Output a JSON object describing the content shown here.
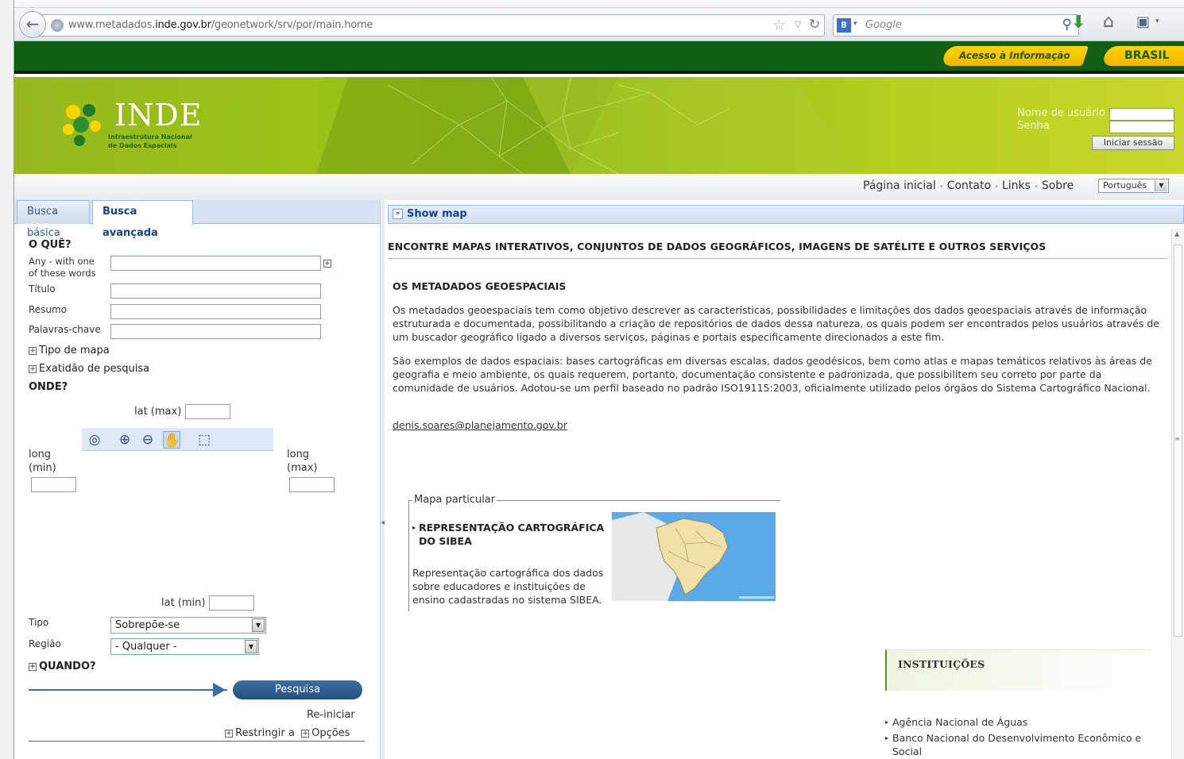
{
  "browser": {
    "url_prefix": "www.metadados.",
    "url_domain": "inde.gov.br",
    "url_path": "/geonetwork/srv/por/main.home",
    "search_engine": "Google",
    "icons": [
      "back-icon",
      "globe-icon",
      "star-icon",
      "reload-icon",
      "google-icon",
      "search-icon",
      "download-icon",
      "home-icon",
      "bookmark-icon"
    ]
  },
  "govbar": {
    "acesso": "Acesso à Informação",
    "brasil": "BRASIL",
    "colors": {
      "bar": "#0f5f14",
      "badge": "#ffd400"
    }
  },
  "banner": {
    "logo_name": "INDE",
    "logo_sub_1": "Infraestrutura Nacional",
    "logo_sub_2": "de Dados Espaciais",
    "username_label": "Nome de usuário",
    "password_label": "Senha",
    "login_button": "Iniciar sessão"
  },
  "nav": {
    "links": [
      "Página inicial",
      "Contato",
      "Links",
      "Sobre"
    ],
    "language": "Português"
  },
  "tabs": {
    "basic": "Busca básica",
    "advanced": "Busca avançada"
  },
  "search": {
    "what_heading": "O QUÊ?",
    "any_label_1": "Any - with one",
    "any_label_2": "of these words",
    "titulo_label": "Título",
    "resumo_label": "Resumo",
    "palavras_label": "Palavras-chave",
    "tipo_mapa": "Tipo de mapa",
    "exatidao": "Exatidão de pesquisa",
    "where_heading": "ONDE?",
    "lat_max": "lat (max)",
    "lat_min": "lat (min)",
    "long_min_1": "long",
    "long_min_2": "(min)",
    "long_max_1": "long",
    "long_max_2": "(max)",
    "tipo_label": "Tipo",
    "tipo_value": "Sobrepõe-se",
    "regiao_label": "Região",
    "regiao_value": "- Qualquer -",
    "when_heading": "QUANDO?",
    "search_button": "Pesquisa",
    "reset": "Re-iniciar",
    "restringir": "Restringir a",
    "opcoes": "Opções"
  },
  "main": {
    "show_map": "Show map",
    "title": "ENCONTRE MAPAS INTERATIVOS, CONJUNTOS DE DADOS GEOGRÁFICOS, IMAGENS DE SATÉLITE E OUTROS SERVIÇOS",
    "section_title": "OS METADADOS GEOESPACIAIS",
    "para1": "Os metadados geoespaciais tem como objetivo descrever as características, possibilidades e limitações dos dados geoespaciais através de informação estruturada e documentada, possibilitando a criação de repositórios de dados dessa natureza, os quais podem ser encontrados pelos usuários através de um buscador geográfico ligado a diversos serviços, páginas e portais especificamente direcionados a este fim.",
    "para2": "São exemplos de dados espaciais: bases cartográficas em diversas escalas, dados geodésicos, bem como atlas e mapas temáticos relativos às áreas de geografia e meio ambiente, os quais requerem, portanto, documentação consistente e padronizada, que possibilitem seu correto por parte da comunidade de usuários. Adotou-se um perfil baseado no padrão ISO19115:2003, oficialmente utilizado pelos órgãos do Sistema Cartográfico Nacional.",
    "email": "denis.soares@planejamento.gov.br",
    "featured_legend": "Mapa particular",
    "featured_title": "REPRESENTAÇÃO CARTOGRÁFICA DO SIBEA",
    "featured_desc": "Representação cartográfica dos dados sobre educadores e instituições de ensino cadastradas no sistema SIBEA.",
    "institutions_title": "INSTITUIÇÕES",
    "institutions": [
      "Agência Nacional de Águas",
      "Banco Nacional do Desenvolvimento Econômico e Social"
    ]
  }
}
